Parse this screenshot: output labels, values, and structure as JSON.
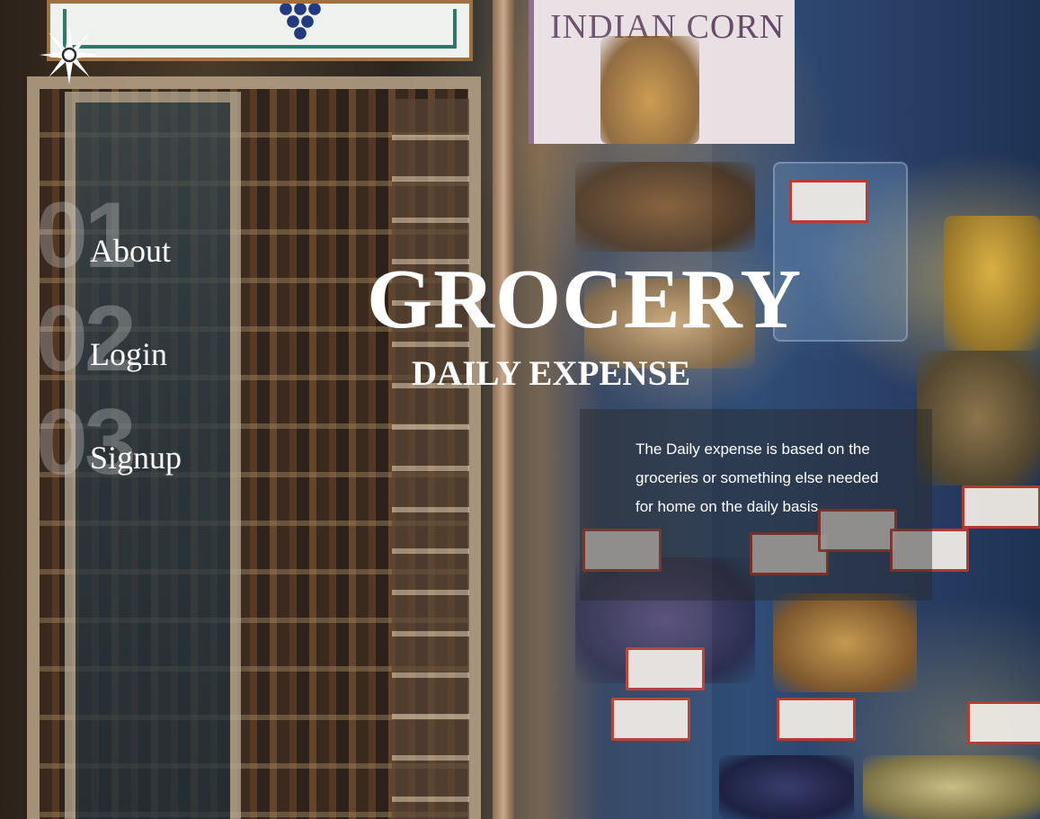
{
  "nav": {
    "items": [
      {
        "number": "01",
        "label": "About"
      },
      {
        "number": "02",
        "label": "Login"
      },
      {
        "number": "03",
        "label": "Signup"
      }
    ]
  },
  "hero": {
    "title": "GROCERY",
    "subtitle": "DAILY EXPENSE",
    "description": "The Daily expense is based on the groceries or something else needed for home on the daily basis"
  },
  "background": {
    "sign_text": "INDIAN CORN"
  },
  "colors": {
    "text": "#ffffff",
    "nav_number": "#d2d2d2"
  },
  "icons": {
    "logo": "star-burst-logo-icon"
  }
}
